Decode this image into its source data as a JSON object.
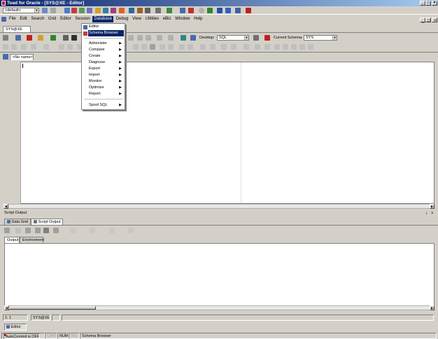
{
  "window": {
    "title": "Toad for Oracle - [SYS@XE - Editor]",
    "minimize": "_",
    "maximize": "□",
    "close": "×"
  },
  "mdi": {
    "minimize": "_",
    "restore": "□",
    "close": "×"
  },
  "toolbar1": {
    "connection_combo": "<default>"
  },
  "menubar": {
    "items": [
      "File",
      "Edit",
      "Search",
      "Grid",
      "Editor",
      "Session",
      "Database",
      "Debug",
      "View",
      "Utilities",
      "eBiz",
      "Window",
      "Help"
    ]
  },
  "connection_tab": "SYS@XE",
  "toolbar3": {
    "desktop_label": "Desktop:",
    "desktop_value": "SQL",
    "schema_label": "Current Schema:",
    "schema_value": "SYS"
  },
  "doc_tab": "<No name>",
  "database_menu": {
    "items": [
      "Editor",
      "Schema Browser",
      "Administer",
      "Compare",
      "Create",
      "Diagnose",
      "Export",
      "Import",
      "Monitor",
      "Optimize",
      "Report",
      "Spool SQL"
    ],
    "selected": "Schema Browser"
  },
  "output_panel": {
    "title": "Script Output",
    "pin": "↕",
    "close": "×",
    "tabs": [
      "Data Grid",
      "Script Output"
    ],
    "subtabs": [
      "Output",
      "Environment"
    ]
  },
  "statusbar": {
    "position": "1: 1",
    "connection": "SYS@XE"
  },
  "taskbar": {
    "editor_label": "Editor"
  },
  "bottom_status": {
    "autocommit": "AutoCommit is OFF",
    "caps": "CAPS",
    "num": "NUM",
    "ins": "INS",
    "message": "Schema Browser"
  },
  "colors": {
    "titlebar": "#0a246a",
    "menu_highlight": "#0a246a",
    "chrome": "#d4d0c8"
  }
}
